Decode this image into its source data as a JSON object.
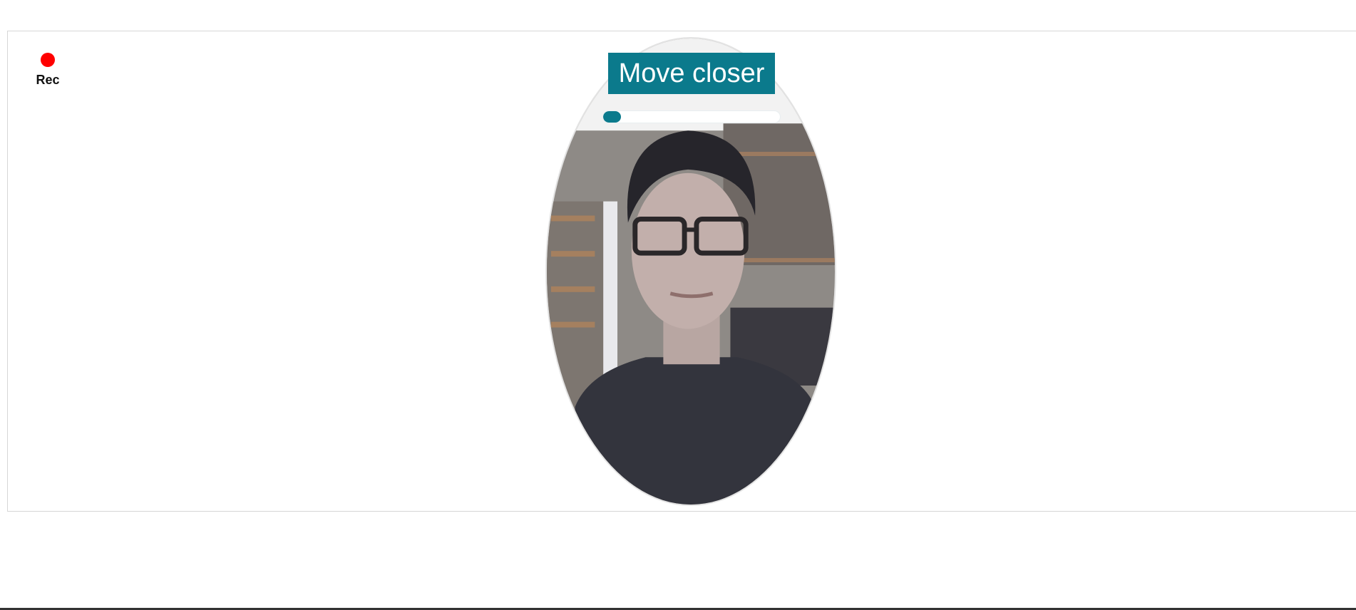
{
  "recording": {
    "label": "Rec",
    "dot_color": "#ff0000"
  },
  "camera": {
    "instruction": "Move closer",
    "progress_fraction": 0.1,
    "accent_color": "#0b7a8c"
  }
}
